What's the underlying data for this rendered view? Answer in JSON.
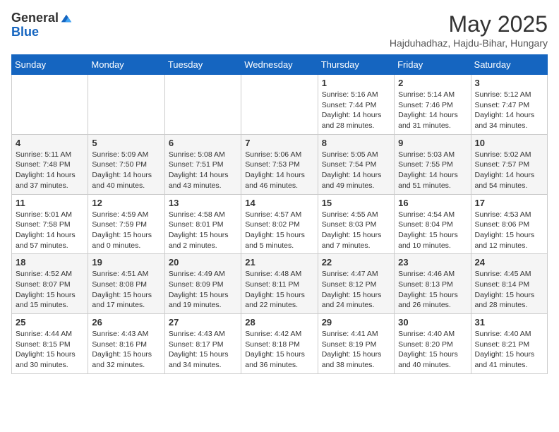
{
  "logo": {
    "general": "General",
    "blue": "Blue"
  },
  "title": "May 2025",
  "location": "Hajduhadhaz, Hajdu-Bihar, Hungary",
  "days_of_week": [
    "Sunday",
    "Monday",
    "Tuesday",
    "Wednesday",
    "Thursday",
    "Friday",
    "Saturday"
  ],
  "weeks": [
    [
      {
        "day": "",
        "info": ""
      },
      {
        "day": "",
        "info": ""
      },
      {
        "day": "",
        "info": ""
      },
      {
        "day": "",
        "info": ""
      },
      {
        "day": "1",
        "info": "Sunrise: 5:16 AM\nSunset: 7:44 PM\nDaylight: 14 hours\nand 28 minutes."
      },
      {
        "day": "2",
        "info": "Sunrise: 5:14 AM\nSunset: 7:46 PM\nDaylight: 14 hours\nand 31 minutes."
      },
      {
        "day": "3",
        "info": "Sunrise: 5:12 AM\nSunset: 7:47 PM\nDaylight: 14 hours\nand 34 minutes."
      }
    ],
    [
      {
        "day": "4",
        "info": "Sunrise: 5:11 AM\nSunset: 7:48 PM\nDaylight: 14 hours\nand 37 minutes."
      },
      {
        "day": "5",
        "info": "Sunrise: 5:09 AM\nSunset: 7:50 PM\nDaylight: 14 hours\nand 40 minutes."
      },
      {
        "day": "6",
        "info": "Sunrise: 5:08 AM\nSunset: 7:51 PM\nDaylight: 14 hours\nand 43 minutes."
      },
      {
        "day": "7",
        "info": "Sunrise: 5:06 AM\nSunset: 7:53 PM\nDaylight: 14 hours\nand 46 minutes."
      },
      {
        "day": "8",
        "info": "Sunrise: 5:05 AM\nSunset: 7:54 PM\nDaylight: 14 hours\nand 49 minutes."
      },
      {
        "day": "9",
        "info": "Sunrise: 5:03 AM\nSunset: 7:55 PM\nDaylight: 14 hours\nand 51 minutes."
      },
      {
        "day": "10",
        "info": "Sunrise: 5:02 AM\nSunset: 7:57 PM\nDaylight: 14 hours\nand 54 minutes."
      }
    ],
    [
      {
        "day": "11",
        "info": "Sunrise: 5:01 AM\nSunset: 7:58 PM\nDaylight: 14 hours\nand 57 minutes."
      },
      {
        "day": "12",
        "info": "Sunrise: 4:59 AM\nSunset: 7:59 PM\nDaylight: 15 hours\nand 0 minutes."
      },
      {
        "day": "13",
        "info": "Sunrise: 4:58 AM\nSunset: 8:01 PM\nDaylight: 15 hours\nand 2 minutes."
      },
      {
        "day": "14",
        "info": "Sunrise: 4:57 AM\nSunset: 8:02 PM\nDaylight: 15 hours\nand 5 minutes."
      },
      {
        "day": "15",
        "info": "Sunrise: 4:55 AM\nSunset: 8:03 PM\nDaylight: 15 hours\nand 7 minutes."
      },
      {
        "day": "16",
        "info": "Sunrise: 4:54 AM\nSunset: 8:04 PM\nDaylight: 15 hours\nand 10 minutes."
      },
      {
        "day": "17",
        "info": "Sunrise: 4:53 AM\nSunset: 8:06 PM\nDaylight: 15 hours\nand 12 minutes."
      }
    ],
    [
      {
        "day": "18",
        "info": "Sunrise: 4:52 AM\nSunset: 8:07 PM\nDaylight: 15 hours\nand 15 minutes."
      },
      {
        "day": "19",
        "info": "Sunrise: 4:51 AM\nSunset: 8:08 PM\nDaylight: 15 hours\nand 17 minutes."
      },
      {
        "day": "20",
        "info": "Sunrise: 4:49 AM\nSunset: 8:09 PM\nDaylight: 15 hours\nand 19 minutes."
      },
      {
        "day": "21",
        "info": "Sunrise: 4:48 AM\nSunset: 8:11 PM\nDaylight: 15 hours\nand 22 minutes."
      },
      {
        "day": "22",
        "info": "Sunrise: 4:47 AM\nSunset: 8:12 PM\nDaylight: 15 hours\nand 24 minutes."
      },
      {
        "day": "23",
        "info": "Sunrise: 4:46 AM\nSunset: 8:13 PM\nDaylight: 15 hours\nand 26 minutes."
      },
      {
        "day": "24",
        "info": "Sunrise: 4:45 AM\nSunset: 8:14 PM\nDaylight: 15 hours\nand 28 minutes."
      }
    ],
    [
      {
        "day": "25",
        "info": "Sunrise: 4:44 AM\nSunset: 8:15 PM\nDaylight: 15 hours\nand 30 minutes."
      },
      {
        "day": "26",
        "info": "Sunrise: 4:43 AM\nSunset: 8:16 PM\nDaylight: 15 hours\nand 32 minutes."
      },
      {
        "day": "27",
        "info": "Sunrise: 4:43 AM\nSunset: 8:17 PM\nDaylight: 15 hours\nand 34 minutes."
      },
      {
        "day": "28",
        "info": "Sunrise: 4:42 AM\nSunset: 8:18 PM\nDaylight: 15 hours\nand 36 minutes."
      },
      {
        "day": "29",
        "info": "Sunrise: 4:41 AM\nSunset: 8:19 PM\nDaylight: 15 hours\nand 38 minutes."
      },
      {
        "day": "30",
        "info": "Sunrise: 4:40 AM\nSunset: 8:20 PM\nDaylight: 15 hours\nand 40 minutes."
      },
      {
        "day": "31",
        "info": "Sunrise: 4:40 AM\nSunset: 8:21 PM\nDaylight: 15 hours\nand 41 minutes."
      }
    ]
  ]
}
